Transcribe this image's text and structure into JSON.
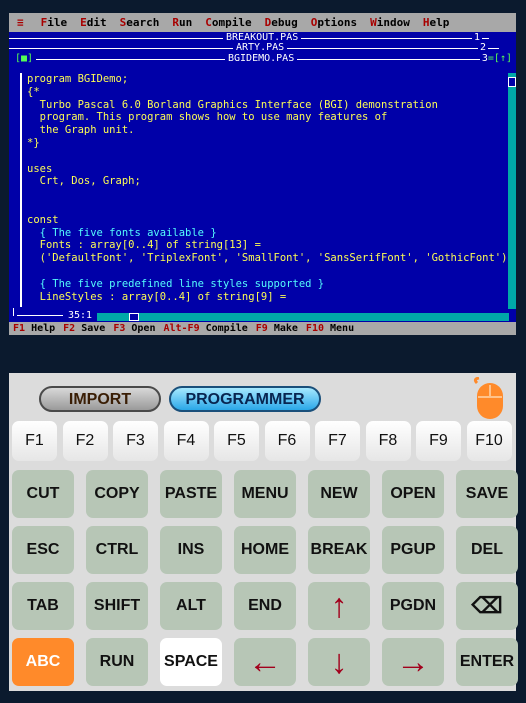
{
  "menubar": {
    "items": [
      {
        "hot": "≡",
        "rest": ""
      },
      {
        "hot": "F",
        "rest": "ile"
      },
      {
        "hot": "E",
        "rest": "dit"
      },
      {
        "hot": "S",
        "rest": "earch"
      },
      {
        "hot": "R",
        "rest": "un"
      },
      {
        "hot": "C",
        "rest": "ompile"
      },
      {
        "hot": "D",
        "rest": "ebug"
      },
      {
        "hot": "O",
        "rest": "ptions"
      },
      {
        "hot": "W",
        "rest": "indow"
      },
      {
        "hot": "H",
        "rest": "elp"
      }
    ]
  },
  "windows": [
    {
      "title": "BREAKOUT.PAS",
      "number": "1"
    },
    {
      "title": "ARTY.PAS",
      "number": "2"
    },
    {
      "title": "BGIDEMO.PAS",
      "number": "3",
      "left_marker": "[■]",
      "right_marker": "=[↑]"
    }
  ],
  "code_lines": [
    {
      "t": "program BGIDemo;",
      "k": "d"
    },
    {
      "t": "{*",
      "k": "d"
    },
    {
      "t": "  Turbo Pascal 6.0 Borland Graphics Interface (BGI) demonstration",
      "k": "d"
    },
    {
      "t": "  program. This program shows how to use many features of",
      "k": "d"
    },
    {
      "t": "  the Graph unit.",
      "k": "d"
    },
    {
      "t": "*}",
      "k": "d"
    },
    {
      "t": "",
      "k": "d"
    },
    {
      "t": "uses",
      "k": "d"
    },
    {
      "t": "  Crt, Dos, Graph;",
      "k": "d"
    },
    {
      "t": "",
      "k": "d"
    },
    {
      "t": "",
      "k": "d"
    },
    {
      "t": "const",
      "k": "d"
    },
    {
      "t": "  { The five fonts available }",
      "k": "c"
    },
    {
      "t": "  Fonts : array[0..4] of string[13] =",
      "k": "d"
    },
    {
      "t": "  ('DefaultFont', 'TriplexFont', 'SmallFont', 'SansSerifFont', 'GothicFont')",
      "k": "d"
    },
    {
      "t": "",
      "k": "d"
    },
    {
      "t": "  { The five predefined line styles supported }",
      "k": "c"
    },
    {
      "t": "  LineStyles : array[0..4] of string[9] =",
      "k": "d"
    }
  ],
  "status": {
    "position": "35:1"
  },
  "fkeys": [
    {
      "hot": "F1",
      "label": " Help"
    },
    {
      "hot": "F2",
      "label": " Save"
    },
    {
      "hot": "F3",
      "label": " Open"
    },
    {
      "hot": "Alt-F9",
      "label": " Compile"
    },
    {
      "hot": "F9",
      "label": " Make"
    },
    {
      "hot": "F10",
      "label": " Menu"
    }
  ],
  "keyboard": {
    "mode_import": "IMPORT",
    "mode_programmer": "PROGRAMMER",
    "fkeys": [
      "F1",
      "F2",
      "F3",
      "F4",
      "F5",
      "F6",
      "F7",
      "F8",
      "F9",
      "F10"
    ],
    "rows": [
      [
        "CUT",
        "COPY",
        "PASTE",
        "MENU",
        "NEW",
        "OPEN",
        "SAVE"
      ],
      [
        "ESC",
        "CTRL",
        "INS",
        "HOME",
        "BREAK",
        "PGUP",
        "DEL"
      ],
      [
        "TAB",
        "SHIFT",
        "ALT",
        "END",
        "↑",
        "PGDN",
        "⌫"
      ],
      [
        "ABC",
        "RUN",
        "SPACE",
        "←",
        "↓",
        "→",
        "ENTER"
      ]
    ]
  },
  "colors": {
    "dos_blue": "#0000a8",
    "dos_gray": "#a8a8a8",
    "dos_yellow": "#fcfc54",
    "dos_cyan": "#54fcfc",
    "arrow_red": "#a2001c",
    "key_green": "#b7c6b6",
    "abc_orange": "#ff8a2a"
  }
}
